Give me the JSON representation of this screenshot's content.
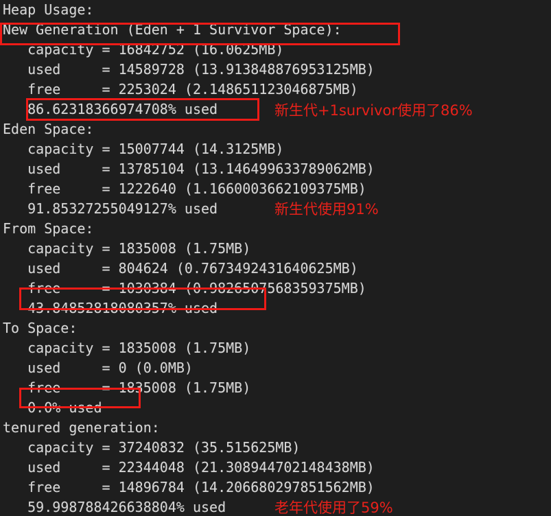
{
  "terminal": {
    "title": "Heap Usage jmap output",
    "background_color": "#1e1e1e",
    "text_color": "#d6d6d6",
    "highlight_color": "#ee1b17",
    "annotation_color": "#e8211a",
    "lines": [
      {
        "text": "Heap Usage:"
      },
      {
        "text": "New Generation (Eden + 1 Survivor Space):"
      },
      {
        "text": "   capacity = 16842752 (16.0625MB)"
      },
      {
        "text": "   used     = 14589728 (13.913848876953125MB)"
      },
      {
        "text": "   free     = 2253024 (2.148651123046875MB)"
      },
      {
        "text": "   86.62318366974708% used"
      },
      {
        "text": "Eden Space:"
      },
      {
        "text": "   capacity = 15007744 (14.3125MB)"
      },
      {
        "text": "   used     = 13785104 (13.146499633789062MB)"
      },
      {
        "text": "   free     = 1222640 (1.1660003662109375MB)"
      },
      {
        "text": "   91.85327255049127% used"
      },
      {
        "text": "From Space:"
      },
      {
        "text": "   capacity = 1835008 (1.75MB)"
      },
      {
        "text": "   used     = 804624 (0.7673492431640625MB)"
      },
      {
        "text": "   free     = 1030384 (0.9826507568359375MB)"
      },
      {
        "text": "   43.84852818080357% used"
      },
      {
        "text": "To Space:"
      },
      {
        "text": "   capacity = 1835008 (1.75MB)"
      },
      {
        "text": "   used     = 0 (0.0MB)"
      },
      {
        "text": "   free     = 1835008 (1.75MB)"
      },
      {
        "text": "   0.0% used"
      },
      {
        "text": "tenured generation:"
      },
      {
        "text": "   capacity = 37240832 (35.515625MB)"
      },
      {
        "text": "   used     = 22344048 (21.308944702148438MB)"
      },
      {
        "text": "   free     = 14896784 (14.206680297851562MB)"
      },
      {
        "text": "   59.998788426638804% used"
      }
    ],
    "annotations": [
      {
        "text": "新生代+1survivor使用了86%"
      },
      {
        "text": "新生代使用91%"
      },
      {
        "text": "老年代使用了59%"
      }
    ]
  }
}
